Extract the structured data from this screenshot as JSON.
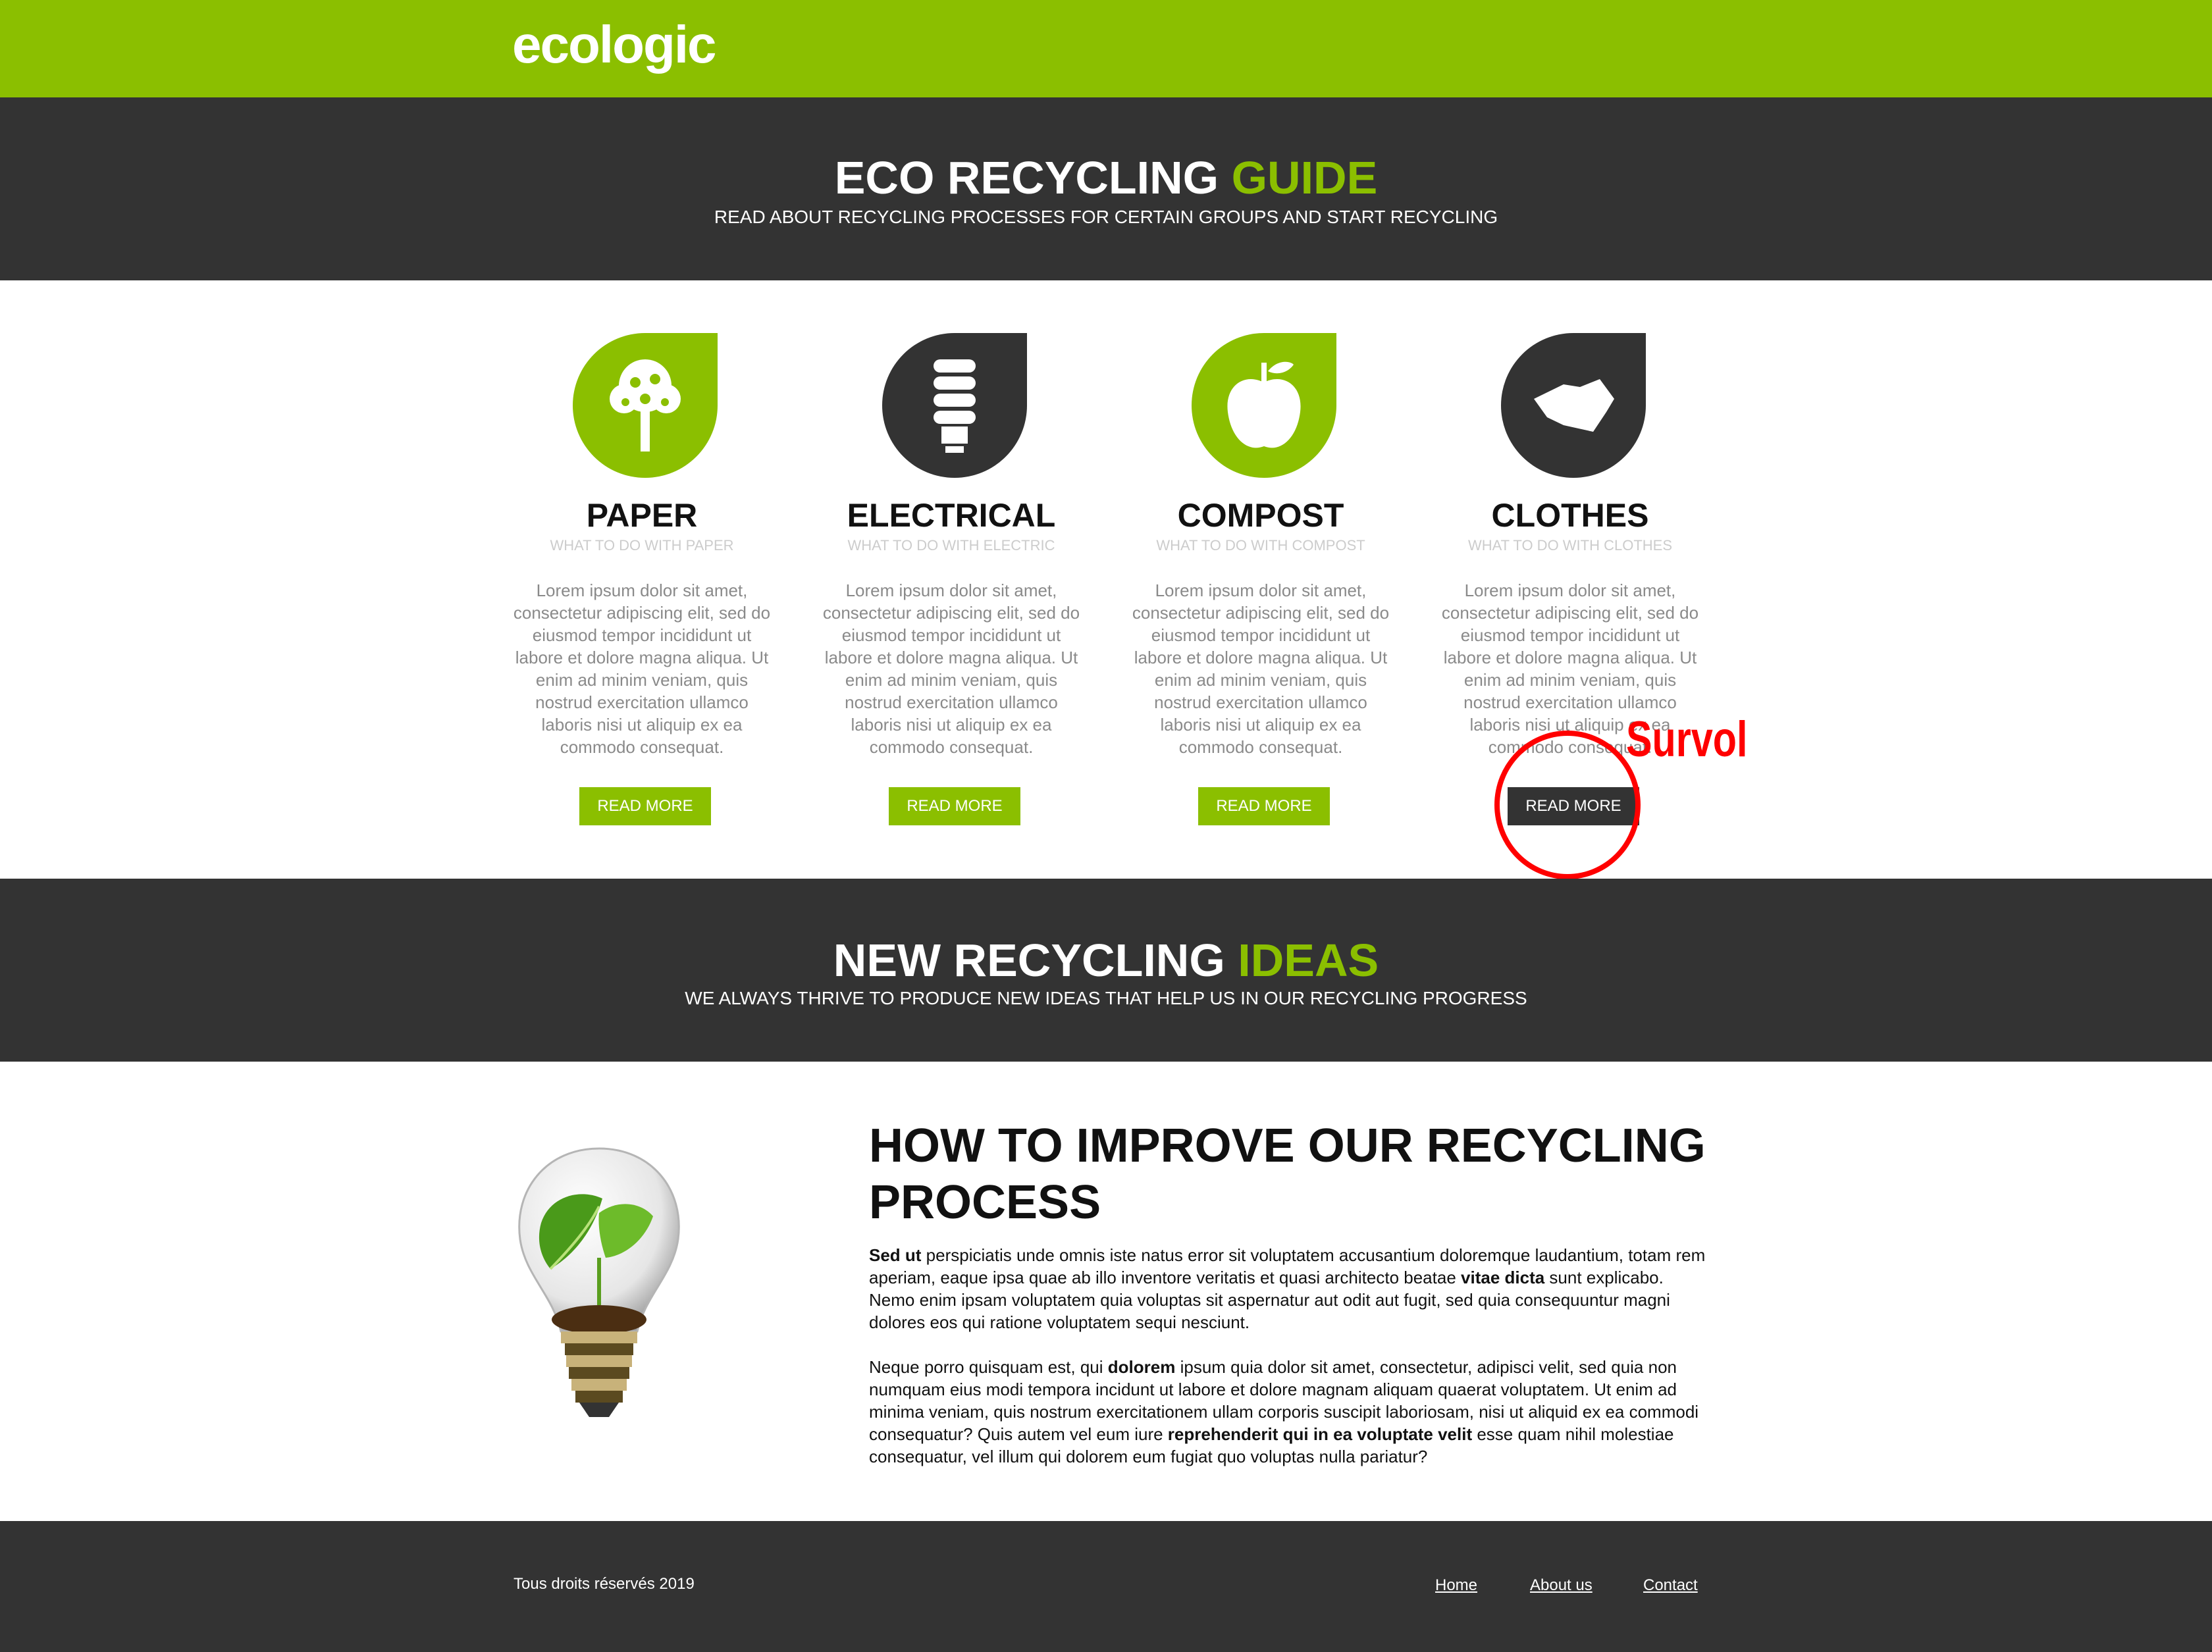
{
  "brand": {
    "logo": "ecologic"
  },
  "banner1": {
    "title_main": "ECO RECYCLING ",
    "title_accent": "GUIDE",
    "subtitle": "READ ABOUT RECYCLING PROCESSES FOR CERTAIN GROUPS AND START RECYCLING"
  },
  "cards": [
    {
      "icon": "tree-icon",
      "icon_color": "#8bbf00",
      "title": "PAPER",
      "subtitle": "WHAT TO DO WITH PAPER",
      "body": "Lorem ipsum dolor sit amet, consectetur adipiscing elit, sed do eiusmod tempor incididunt ut labore et dolore magna aliqua. Ut enim ad minim veniam, quis nostrud exercitation ullamco laboris nisi ut aliquip ex ea commodo consequat.",
      "button": "READ MORE"
    },
    {
      "icon": "lightbulb-icon",
      "icon_color": "#333333",
      "title": "ELECTRICAL",
      "subtitle": "WHAT TO DO WITH ELECTRIC",
      "body": "Lorem ipsum dolor sit amet, consectetur adipiscing elit, sed do eiusmod tempor incididunt ut labore et dolore magna aliqua. Ut enim ad minim veniam, quis nostrud exercitation ullamco laboris nisi ut aliquip ex ea commodo consequat.",
      "button": "READ MORE"
    },
    {
      "icon": "apple-icon",
      "icon_color": "#8bbf00",
      "title": "COMPOST",
      "subtitle": "WHAT TO DO WITH COMPOST",
      "body": "Lorem ipsum dolor sit amet, consectetur adipiscing elit, sed do eiusmod tempor incididunt ut labore et dolore magna aliqua. Ut enim ad minim veniam, quis nostrud exercitation ullamco laboris nisi ut aliquip ex ea commodo consequat.",
      "button": "READ MORE"
    },
    {
      "icon": "cloth-icon",
      "icon_color": "#333333",
      "title": "CLOTHES",
      "subtitle": "WHAT TO DO WITH CLOTHES",
      "body": "Lorem ipsum dolor sit amet, consectetur adipiscing elit, sed do eiusmod tempor incididunt ut labore et dolore magna aliqua. Ut enim ad minim veniam, quis nostrud exercitation ullamco laboris nisi ut aliquip ex ea commodo consequat.",
      "button": "READ MORE"
    }
  ],
  "annotation": {
    "label": "Survol",
    "color": "#ff0000"
  },
  "banner2": {
    "title_main": "NEW RECYCLING ",
    "title_accent": "IDEAS",
    "subtitle": "WE ALWAYS THRIVE TO PRODUCE NEW IDEAS THAT HELP US IN OUR RECYCLING PROGRESS"
  },
  "improve": {
    "title": "HOW TO IMPROVE OUR RECYCLING PROCESS",
    "p1": {
      "b1": "Sed ut",
      "t1": " perspiciatis unde omnis iste natus error sit voluptatem accusantium doloremque laudantium, totam rem aperiam, eaque ipsa quae ab illo inventore veritatis et quasi architecto beatae ",
      "b2": "vitae dicta",
      "t2": " sunt explicabo. Nemo enim ipsam voluptatem quia voluptas sit aspernatur aut odit aut fugit, sed quia consequuntur magni dolores eos qui ratione voluptatem sequi nesciunt."
    },
    "p2": {
      "t1": "Neque porro quisquam est, qui ",
      "b1": "dolorem",
      "t2": " ipsum quia dolor sit amet, consectetur, adipisci velit, sed quia non numquam eius modi tempora incidunt ut labore et dolore magnam aliquam quaerat voluptatem. Ut enim ad minima veniam, quis nostrum exercitationem ullam corporis suscipit laboriosam, nisi ut aliquid ex ea commodi consequatur? Quis autem vel eum iure ",
      "b2": "reprehenderit qui in ea voluptate velit",
      "t3": " esse quam nihil molestiae consequatur, vel illum qui dolorem eum fugiat quo voluptas nulla pariatur?"
    }
  },
  "footer": {
    "copyright": "Tous droits réservés 2019",
    "links": [
      "Home",
      "About us",
      "Contact"
    ]
  },
  "colors": {
    "brand_green": "#8bbf00",
    "dark": "#333333"
  }
}
